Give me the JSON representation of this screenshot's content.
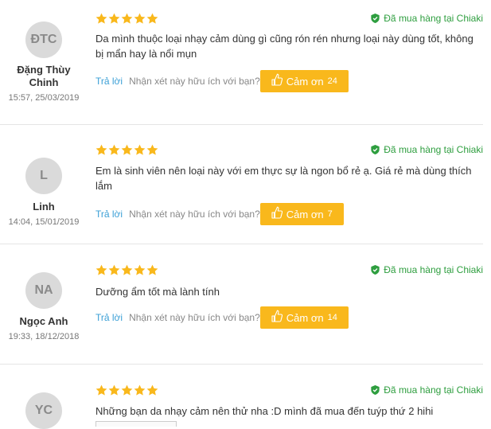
{
  "reviews": [
    {
      "initials": "ĐTC",
      "name": "Đặng Thùy Chinh",
      "date": "15:57, 25/03/2019",
      "rating": 5,
      "verified": "Đã mua hàng tại Chiaki",
      "text": "Da mình thuộc loại nhạy cảm dùng gì cũng rón rén nhưng loại này dùng tốt, không bị mẩn hay là nổi mụn",
      "reply_label": "Trả lời",
      "helpful_question": "Nhận xét này hữu ích với bạn?",
      "thanks_label": "Cảm ơn",
      "thanks_count": "24"
    },
    {
      "initials": "L",
      "name": "Linh",
      "date": "14:04, 15/01/2019",
      "rating": 5,
      "verified": "Đã mua hàng tại Chiaki",
      "text": "Em là sinh viên nên loại này với em thực sự là ngon bổ rẻ ạ. Giá rẻ mà dùng thích lắm",
      "reply_label": "Trả lời",
      "helpful_question": "Nhận xét này hữu ích với bạn?",
      "thanks_label": "Cảm ơn",
      "thanks_count": "7"
    },
    {
      "initials": "NA",
      "name": "Ngọc Anh",
      "date": "19:33, 18/12/2018",
      "rating": 5,
      "verified": "Đã mua hàng tại Chiaki",
      "text": "Dưỡng ẩm tốt mà lành tính",
      "reply_label": "Trả lời",
      "helpful_question": "Nhận xét này hữu ích với bạn?",
      "thanks_label": "Cảm ơn",
      "thanks_count": "14"
    },
    {
      "initials": "YC",
      "name": "",
      "date": "",
      "rating": 5,
      "verified": "Đã mua hàng tại Chiaki",
      "text": "Những bạn da nhạy cảm nên thử nha :D mình đã mua đến tuýp thứ 2 hihi",
      "reply_label": "",
      "helpful_question": "",
      "thanks_label": "",
      "thanks_count": ""
    }
  ],
  "colors": {
    "star": "#f9b81c",
    "verified": "#2e9e3f",
    "reply": "#3a9fd6",
    "thanks_bg": "#f9b81c",
    "avatar_bg": "#dadada"
  },
  "icons": {
    "rating": "star-icon",
    "verified": "shield-check-icon",
    "thanks": "thumbs-up-icon"
  }
}
